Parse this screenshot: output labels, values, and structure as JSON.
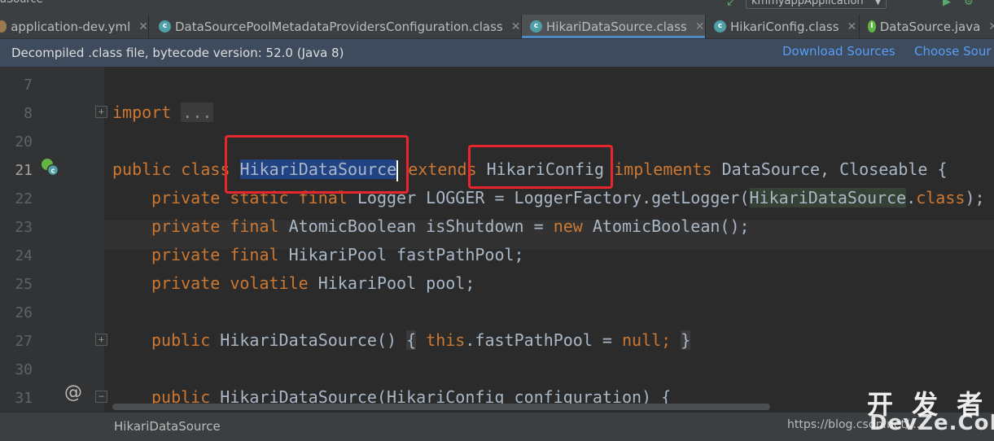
{
  "window": {
    "title_fragment": "aSource",
    "run_config": "kmmyappApplication"
  },
  "tabs": [
    {
      "label": "application-dev.yml",
      "icon": "yml-file-icon"
    },
    {
      "label": "DataSourcePoolMetadataProvidersConfiguration.class",
      "icon": "class-file-icon"
    },
    {
      "label": "HikariDataSource.class",
      "icon": "class-file-icon",
      "active": true
    },
    {
      "label": "HikariConfig.class",
      "icon": "class-file-icon"
    },
    {
      "label": "DataSource.java",
      "icon": "interface-file-icon"
    }
  ],
  "infobar": {
    "message": "Decompiled .class file, bytecode version: 52.0 (Java 8)",
    "download_sources": "Download Sources",
    "choose_sources": "Choose Sour"
  },
  "gutter": {
    "line_numbers": [
      "7",
      "8",
      "20",
      "21",
      "22",
      "23",
      "24",
      "25",
      "26",
      "27",
      "30",
      "31"
    ]
  },
  "code": {
    "l8": {
      "kw": "import",
      "dots": "..."
    },
    "l21": {
      "kw1": "public class",
      "name": "HikariDataSource",
      "kw2": "extends",
      "parent": "HikariConfig",
      "kw3": "implements",
      "rest": "DataSource, Closeable {"
    },
    "l22": {
      "kw": "private static final",
      "a": "Logger LOGGER = LoggerFactory.getLogger(",
      "hl": "HikariDataSource",
      "b": ".",
      "kw2": "class",
      "c": ");"
    },
    "l23": {
      "kw": "private final",
      "a": "AtomicBoolean isShutdown = ",
      "kw2": "new",
      "b": "AtomicBoolean();"
    },
    "l24": {
      "kw": "private final",
      "a": "HikariPool fastPathPool;"
    },
    "l25": {
      "kw": "private volatile",
      "a": "HikariPool pool;"
    },
    "l27": {
      "kw": "public",
      "a": "HikariDataSource()",
      "b1": "{",
      "kw2": "this",
      "c": ".fastPathPool = ",
      "kw3": "null;",
      "b2": "}"
    },
    "l31": {
      "kw": "public",
      "a": "HikariDataSource(HikariConfig configuration) {"
    }
  },
  "statusbar": {
    "breadcrumb": "HikariDataSource",
    "url": "https://blog.csdn.net/..."
  },
  "watermark": {
    "line1": "开 发 者",
    "line2": "DevZe.CoM"
  },
  "colors": {
    "annotation_box": "#e8262d",
    "keyword": "#cc7832",
    "selection": "#214283",
    "link": "#589df6"
  }
}
